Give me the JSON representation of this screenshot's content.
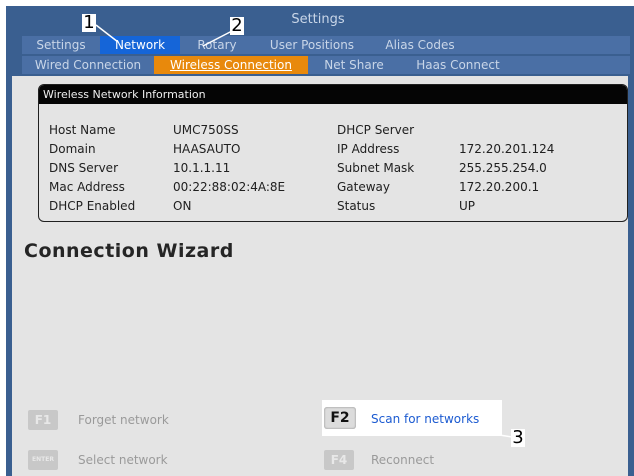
{
  "window": {
    "title": "Settings"
  },
  "tabs_top": [
    {
      "label": "Settings"
    },
    {
      "label": "Network",
      "active": true
    },
    {
      "label": "Rotary"
    },
    {
      "label": "User Positions"
    },
    {
      "label": "Alias Codes"
    }
  ],
  "tabs_network": [
    {
      "label": "Wired Connection"
    },
    {
      "label": "Wireless Connection",
      "active": true
    },
    {
      "label": "Net Share"
    },
    {
      "label": "Haas Connect"
    }
  ],
  "info": {
    "header": "Wireless Network Information",
    "rows": [
      {
        "label": "Host Name",
        "value": "UMC750SS",
        "label2": "DHCP Server",
        "value2": ""
      },
      {
        "label": "Domain",
        "value": "HAASAUTO",
        "label2": "IP Address",
        "value2": "172.20.201.124"
      },
      {
        "label": "DNS Server",
        "value": "10.1.1.11",
        "label2": "Subnet Mask",
        "value2": "255.255.254.0"
      },
      {
        "label": "Mac Address",
        "value": "00:22:88:02:4A:8E",
        "label2": "Gateway",
        "value2": "172.20.200.1"
      },
      {
        "label": "DHCP Enabled",
        "value": "ON",
        "label2": "Status",
        "value2": "UP"
      }
    ]
  },
  "wizard": {
    "title": "Connection Wizard"
  },
  "actions": {
    "f1_key": "F1",
    "f1_label": "Forget network",
    "enter_key": "ENTER",
    "enter_label": "Select network",
    "f2_key": "F2",
    "f2_label": "Scan for networks",
    "f4_key": "F4",
    "f4_label": "Reconnect"
  },
  "callouts": {
    "c1": "1",
    "c2": "2",
    "c3": "3"
  },
  "colors": {
    "frame": "#3a5f90",
    "active_tab": "#1565d8",
    "active_subtab": "#e8890c",
    "link": "#1c5bd1"
  }
}
